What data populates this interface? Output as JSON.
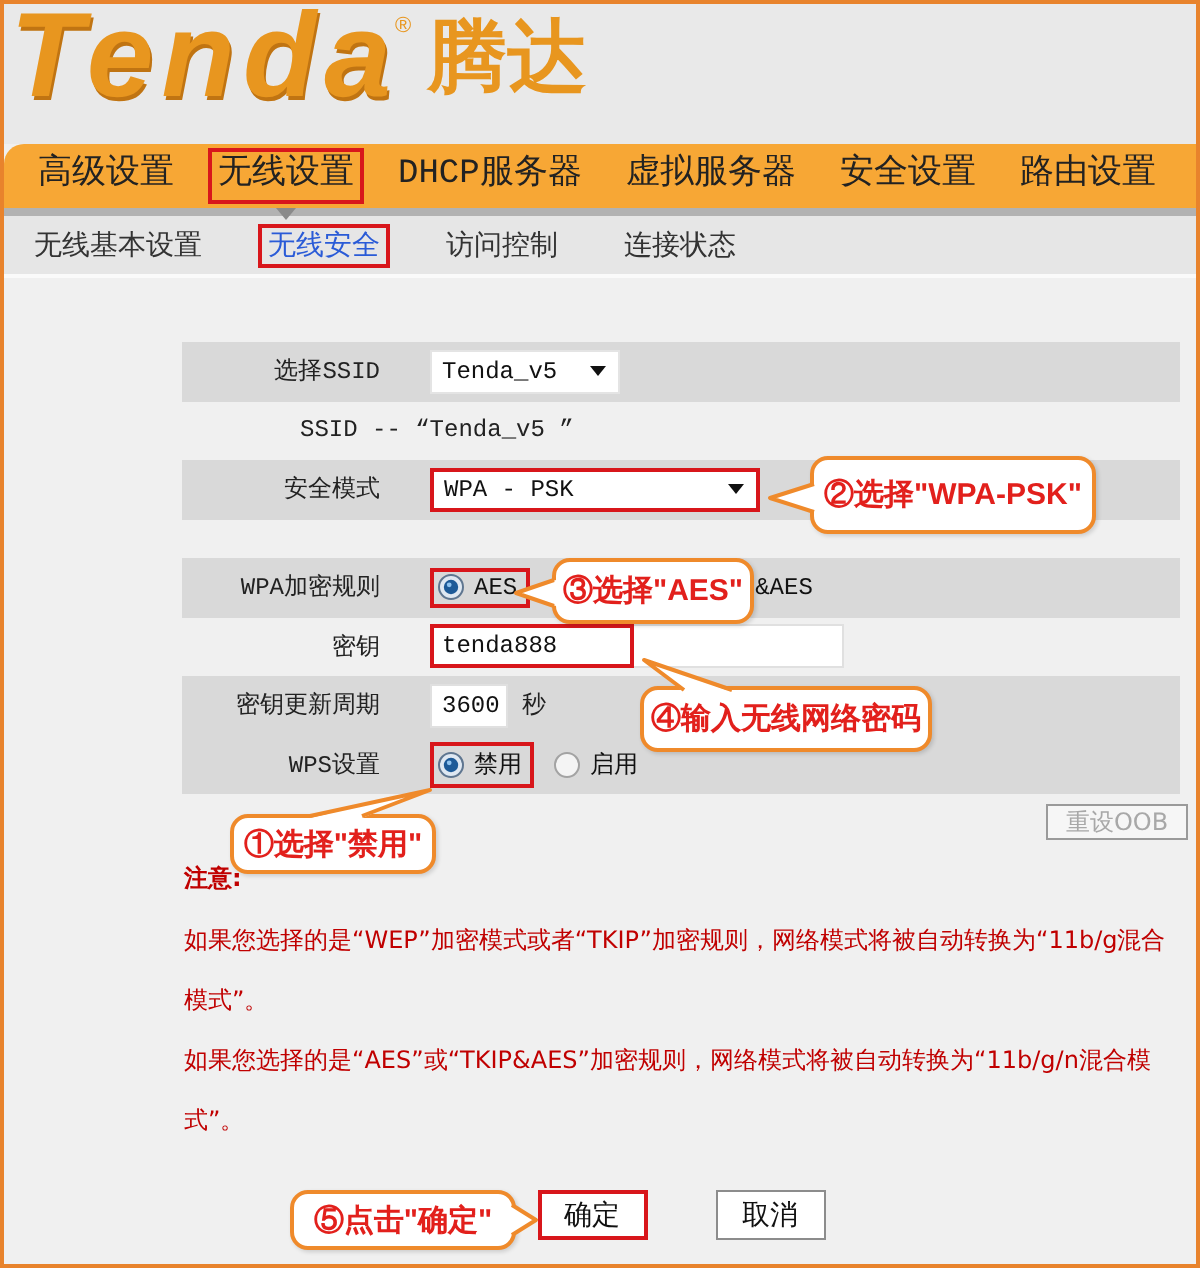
{
  "logo": {
    "wordmark": "Tenda",
    "registered_mark": "®",
    "chinese_name": "腾达"
  },
  "nav": [
    {
      "label": "高级设置",
      "selected": false,
      "highlighted": false
    },
    {
      "label": "无线设置",
      "selected": true,
      "highlighted": true
    },
    {
      "label": "DHCP服务器",
      "selected": false,
      "highlighted": false
    },
    {
      "label": "虚拟服务器",
      "selected": false,
      "highlighted": false
    },
    {
      "label": "安全设置",
      "selected": false,
      "highlighted": false
    },
    {
      "label": "路由设置",
      "selected": false,
      "highlighted": false
    }
  ],
  "subnav": [
    {
      "label": "无线基本设置",
      "selected": false,
      "highlighted": false
    },
    {
      "label": "无线安全",
      "selected": true,
      "highlighted": true
    },
    {
      "label": "访问控制",
      "selected": false,
      "highlighted": false
    },
    {
      "label": "连接状态",
      "selected": false,
      "highlighted": false
    }
  ],
  "form": {
    "sections": [
      [
        {
          "kind": "select",
          "label": "选择SSID",
          "value": "Tenda_v5",
          "shaded": true,
          "highlighted": false
        },
        {
          "kind": "info",
          "text": "SSID -- “Tenda_v5 ”",
          "shaded": false
        },
        {
          "kind": "select",
          "label": "安全模式",
          "value": "WPA - PSK",
          "shaded": true,
          "highlighted": true
        }
      ],
      [
        {
          "kind": "radio",
          "label": "WPA加密规则",
          "shaded": true,
          "options": [
            {
              "label": "AES",
              "selected": true,
              "highlighted": true
            }
          ],
          "covered_text": "&AES"
        },
        {
          "kind": "input",
          "label": "密钥",
          "value": "tenda888",
          "shaded": false,
          "highlighted": true
        },
        {
          "kind": "input",
          "label": "密钥更新周期",
          "value": "3600",
          "unit": "秒",
          "shaded": true,
          "highlighted": false
        },
        {
          "kind": "radio",
          "label": "WPS设置",
          "shaded": true,
          "options": [
            {
              "label": "禁用",
              "selected": true,
              "highlighted": true
            },
            {
              "label": "启用",
              "selected": false,
              "highlighted": false
            }
          ]
        }
      ]
    ],
    "reset_button": {
      "label": "重设OOB",
      "disabled": true
    }
  },
  "notice": {
    "title": "注意:",
    "paragraphs": [
      "如果您选择的是“WEP”加密模式或者“TKIP”加密规则，网络模式将被自动转换为“11b/g混合模式”。",
      "如果您选择的是“AES”或“TKIP&AES”加密规则，网络模式将被自动转换为“11b/g/n混合模式”。"
    ]
  },
  "buttons": [
    {
      "label": "确定",
      "highlighted": true
    },
    {
      "label": "取消",
      "highlighted": false
    }
  ],
  "callouts": [
    {
      "text": "②选择\"WPA-PSK\""
    },
    {
      "text": "③选择\"AES\""
    },
    {
      "text": "④输入无线网络密码"
    },
    {
      "text": "①选择\"禁用\""
    },
    {
      "text": "⑤点击\"确定\""
    }
  ]
}
